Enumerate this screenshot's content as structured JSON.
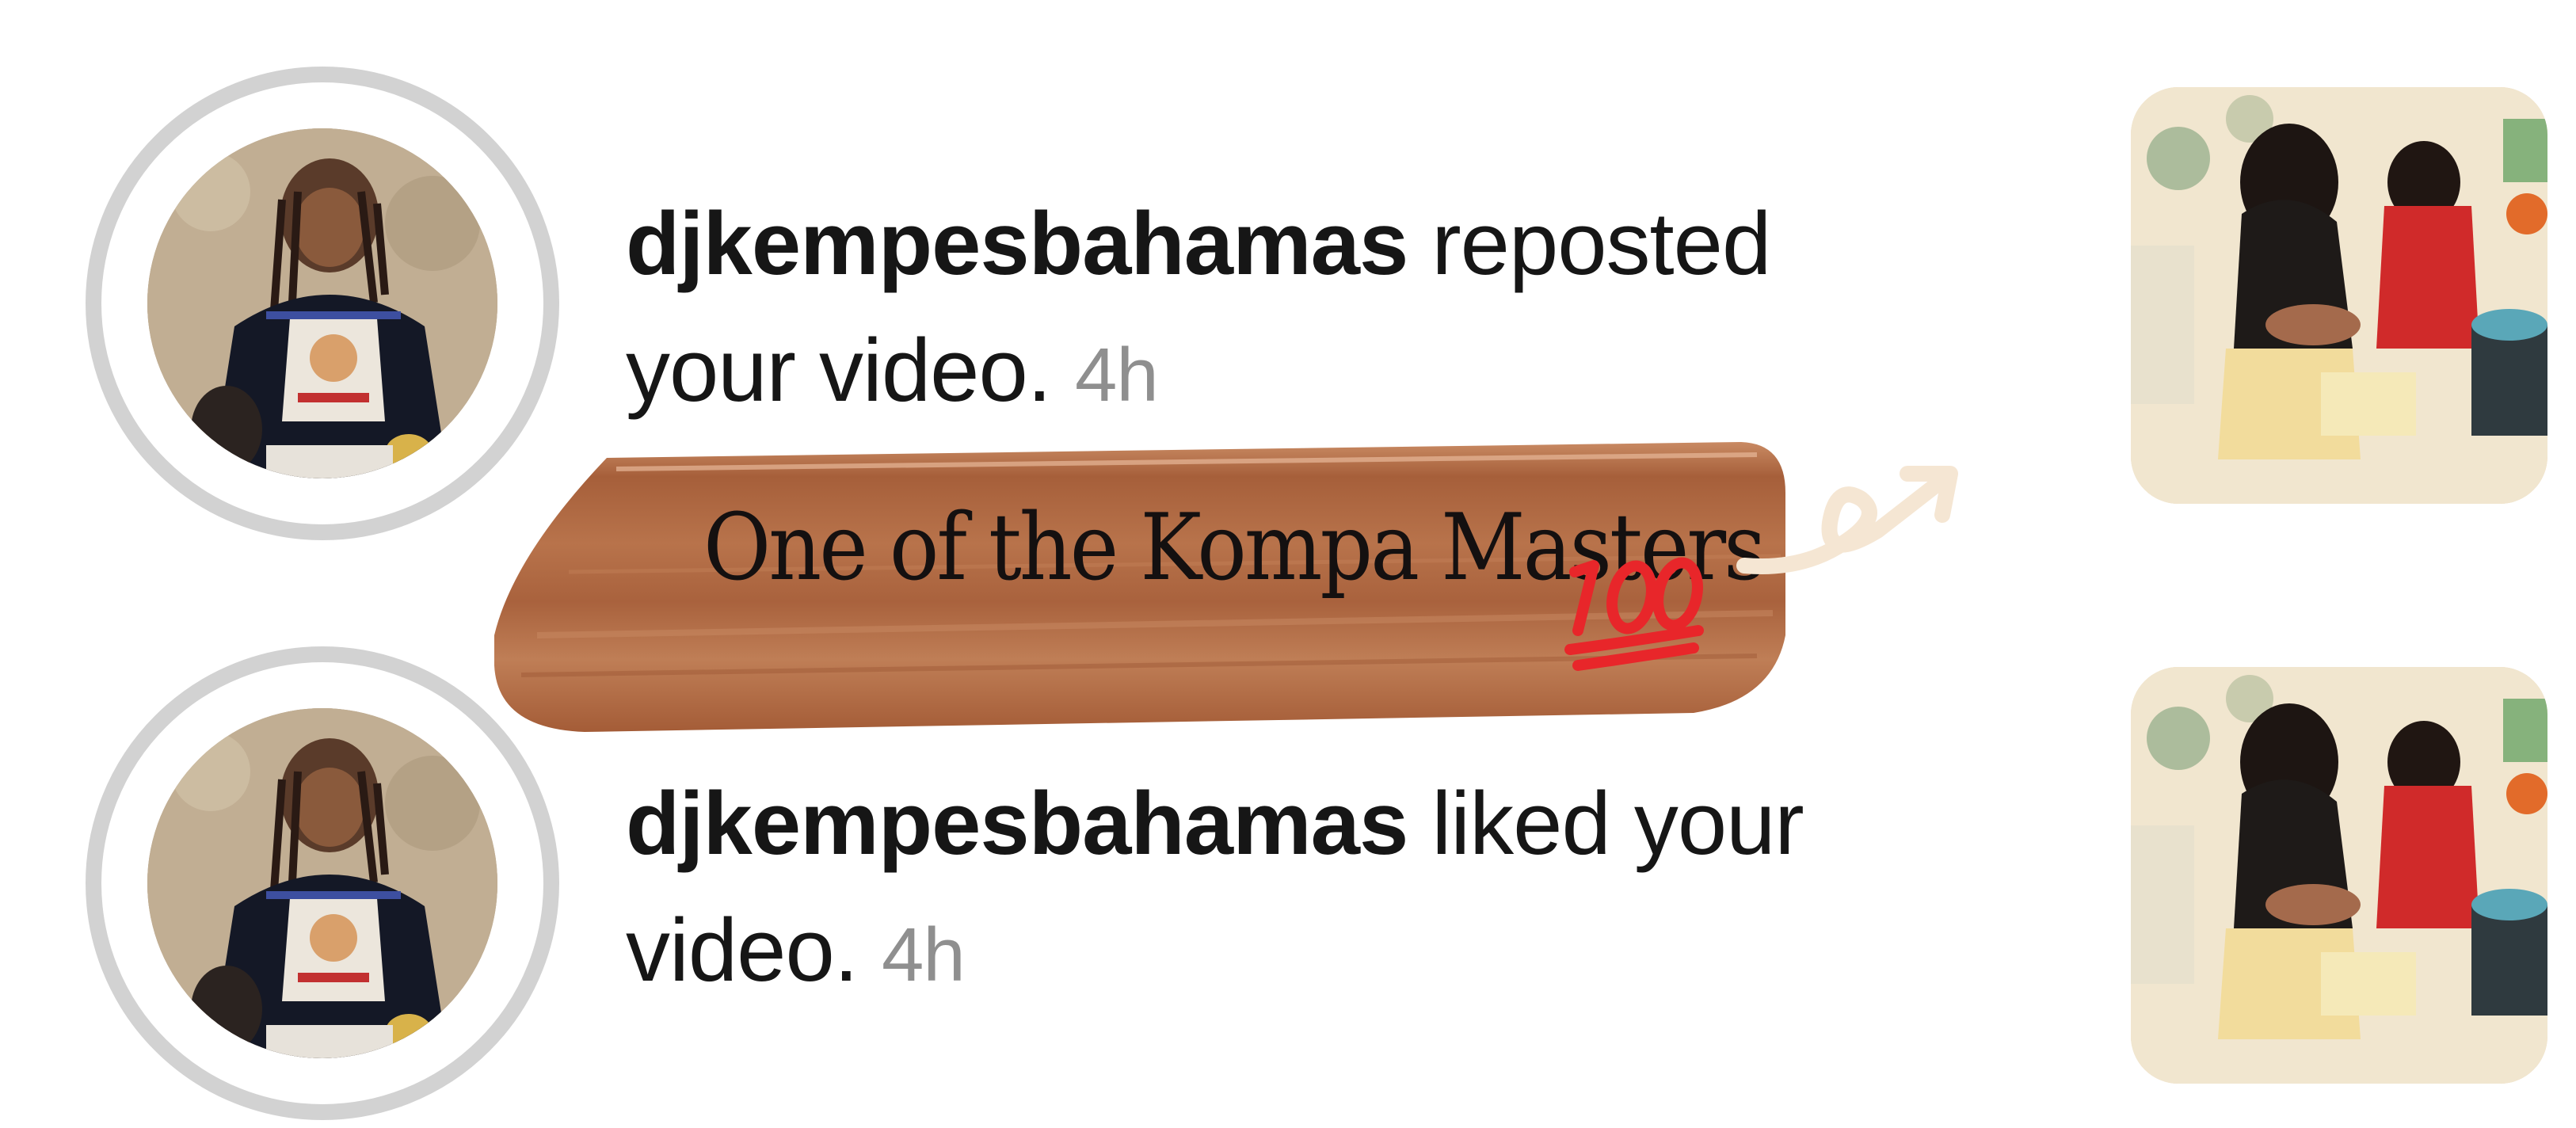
{
  "notifications": [
    {
      "username": "djkempesbahamas",
      "action_line1": " reposted",
      "action_line2": "your video.",
      "time": "4h",
      "avatar_icon": "profile-photo",
      "thumbnail_icon": "video-thumbnail"
    },
    {
      "username": "djkempesbahamas",
      "action_line1": " liked your",
      "action_line2": "video.",
      "time": "4h",
      "avatar_icon": "profile-photo",
      "thumbnail_icon": "video-thumbnail"
    }
  ],
  "caption_sticker": {
    "text": "One of the Kompa Masters",
    "emoji_icon": "hundred-points-icon",
    "arrow_icon": "swoosh-arrow-icon"
  },
  "colors": {
    "text_primary": "#161616",
    "timestamp": "#8f8f8f",
    "avatar_ring": "#d2d2d2",
    "sticker_brown": "#b06a43",
    "emoji_red": "#e8262a"
  }
}
